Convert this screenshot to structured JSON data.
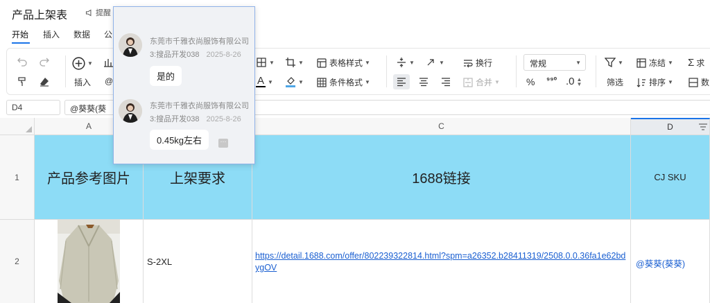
{
  "document": {
    "title": "产品上架表",
    "remind_label": "提醒"
  },
  "menu": {
    "tabs": [
      "开始",
      "插入",
      "数据",
      "公"
    ]
  },
  "ribbon": {
    "insert_label": "插入",
    "table_style_label": "表格样式",
    "cond_format_label": "条件格式",
    "wrap_label": "换行",
    "merge_label": "合并",
    "number_format": "常规",
    "percent_symbol": "%",
    "thousands_symbol": "⁹⁹⁰",
    "decimal_symbol": ".0",
    "filter_label": "筛选",
    "freeze_label": "冻结",
    "sort_label": "排序",
    "sum_label": "求",
    "more_label": "数",
    "icons": [
      "undo-icon",
      "redo-icon",
      "format-painter-icon",
      "eraser-icon",
      "add-circle-icon",
      "chart-icon",
      "border-icon",
      "crop-icon",
      "table-style-icon",
      "condition-format-icon",
      "font-color-icon",
      "fill-color-icon",
      "vertical-align-icon",
      "text-rotate-icon",
      "wrap-icon",
      "align-left-icon",
      "align-center-icon",
      "align-right-icon",
      "merge-icon",
      "filter-icon",
      "freeze-icon",
      "sort-icon",
      "sum-icon",
      "column-icon"
    ],
    "font_color": "#000000",
    "fill_color": "#4ea6e6"
  },
  "formula_bar": {
    "cell_ref": "D4",
    "value": "@葵葵(葵"
  },
  "sheet": {
    "columns": [
      "A",
      "C",
      "D"
    ],
    "rows": [
      "1",
      "2"
    ],
    "header_row": {
      "a": "产品参考图片",
      "b": "上架要求",
      "c": "1688链接",
      "d": "CJ SKU"
    },
    "row2": {
      "b": "S-2XL",
      "c": "https://detail.1688.com/offer/802239322814.html?spm=a26352.b28411319/2508.0.0.36fa1e62bdygOV",
      "d": "@葵葵(葵葵)"
    },
    "header_fill": "#8ddcf6",
    "link_color": "#1a5fd1"
  },
  "comments": [
    {
      "author": "东莞市千雅衣尚服饰有限公司",
      "sub": "3:搜品开发038",
      "date": "2025-8-26",
      "text": "是的"
    },
    {
      "author": "东莞市千雅衣尚服饰有限公司",
      "sub": "3:搜品开发038",
      "date": "2025-8-26",
      "text": "0.45kg左右"
    }
  ],
  "more_glyph": "···"
}
